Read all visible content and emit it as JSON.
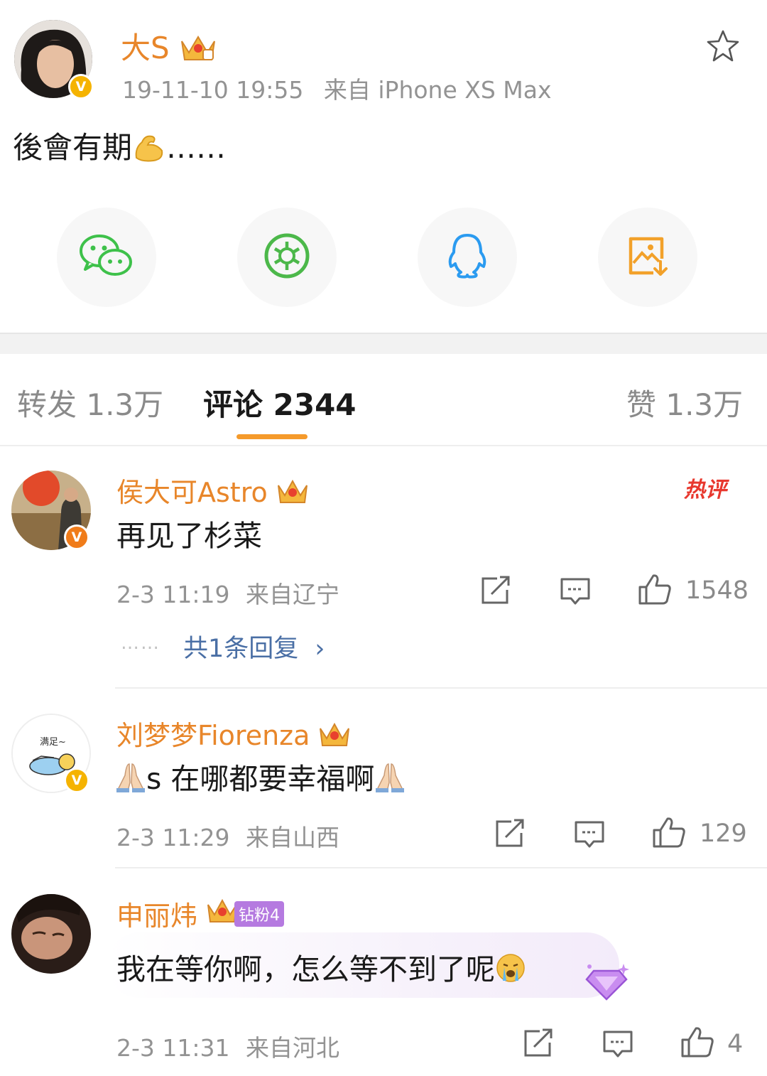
{
  "post": {
    "author": "大S",
    "time": "19-11-10 19:55",
    "source": "来自 iPhone XS Max",
    "text": "後會有期",
    "ellipsis": "……",
    "share_icons": [
      "wechat-icon",
      "moments-icon",
      "qq-icon",
      "save-image-icon"
    ]
  },
  "tabs": {
    "repost": "转发 1.3万",
    "comments": "评论 2344",
    "likes": "赞 1.3万"
  },
  "comments": [
    {
      "name": "侯大可Astro",
      "text": "再见了杉菜",
      "time": "2-3 11:19",
      "location": "来自辽宁",
      "likes": "1548",
      "badge": "热评",
      "replies_label": "共1条回复"
    },
    {
      "name": "刘梦梦Fiorenza",
      "text": "s 在哪都要幸福啊",
      "avatar_text": "满足~",
      "time": "2-3 11:29",
      "location": "来自山西",
      "likes": "129"
    },
    {
      "name": "申丽炜",
      "fan_badge": "钻粉4",
      "text": "我在等你啊，怎么等不到了呢",
      "time": "2-3 11:31",
      "location": "来自河北",
      "likes": "4"
    }
  ],
  "colors": {
    "name_orange": "#e8862a",
    "tab_indicator": "#f59a2b",
    "hot_badge": "#e8382e",
    "reply_link": "#4a6fa5",
    "fan_badge": "#b57ae0"
  }
}
